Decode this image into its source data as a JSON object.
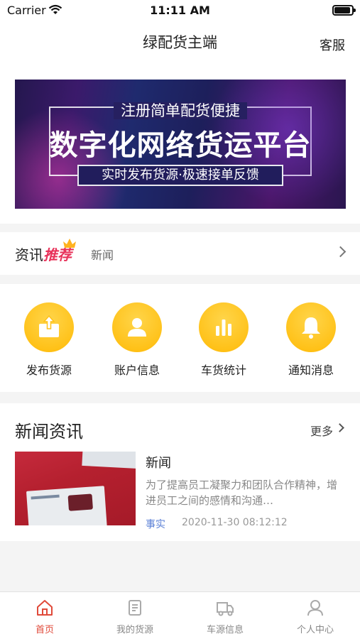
{
  "status_bar": {
    "carrier": "Carrier",
    "time": "11:11 AM"
  },
  "nav": {
    "title": "绿配货主端",
    "service": "客服"
  },
  "banner": {
    "top_text": "注册简单配货便捷",
    "main_text": "数字化网络货运平台",
    "sub_text": "实时发布货源·极速接单反馈"
  },
  "recommend": {
    "label_plain": "资讯",
    "label_hot": "推荐",
    "text": "新闻"
  },
  "menu": {
    "items": [
      {
        "label": "发布货源",
        "icon": "upload-icon"
      },
      {
        "label": "账户信息",
        "icon": "user-icon"
      },
      {
        "label": "车货统计",
        "icon": "chart-bars-icon"
      },
      {
        "label": "通知消息",
        "icon": "bell-icon"
      }
    ]
  },
  "news": {
    "heading": "新闻资讯",
    "more": "更多",
    "items": [
      {
        "title": "新闻",
        "summary": "为了提高员工凝聚力和团队合作精神，增进员工之间的感情和沟通…",
        "tag": "事实",
        "date": "2020-11-30 08:12:12"
      }
    ]
  },
  "tabs": [
    {
      "label": "首页",
      "icon": "home-icon",
      "active": true
    },
    {
      "label": "我的货源",
      "icon": "document-icon",
      "active": false
    },
    {
      "label": "车源信息",
      "icon": "truck-icon",
      "active": false
    },
    {
      "label": "个人中心",
      "icon": "person-icon",
      "active": false
    }
  ],
  "colors": {
    "accent": "#e04a3a",
    "menu_yellow": "#ffc21a",
    "hot": "#e8325a",
    "tag_blue": "#5a7fd6"
  }
}
